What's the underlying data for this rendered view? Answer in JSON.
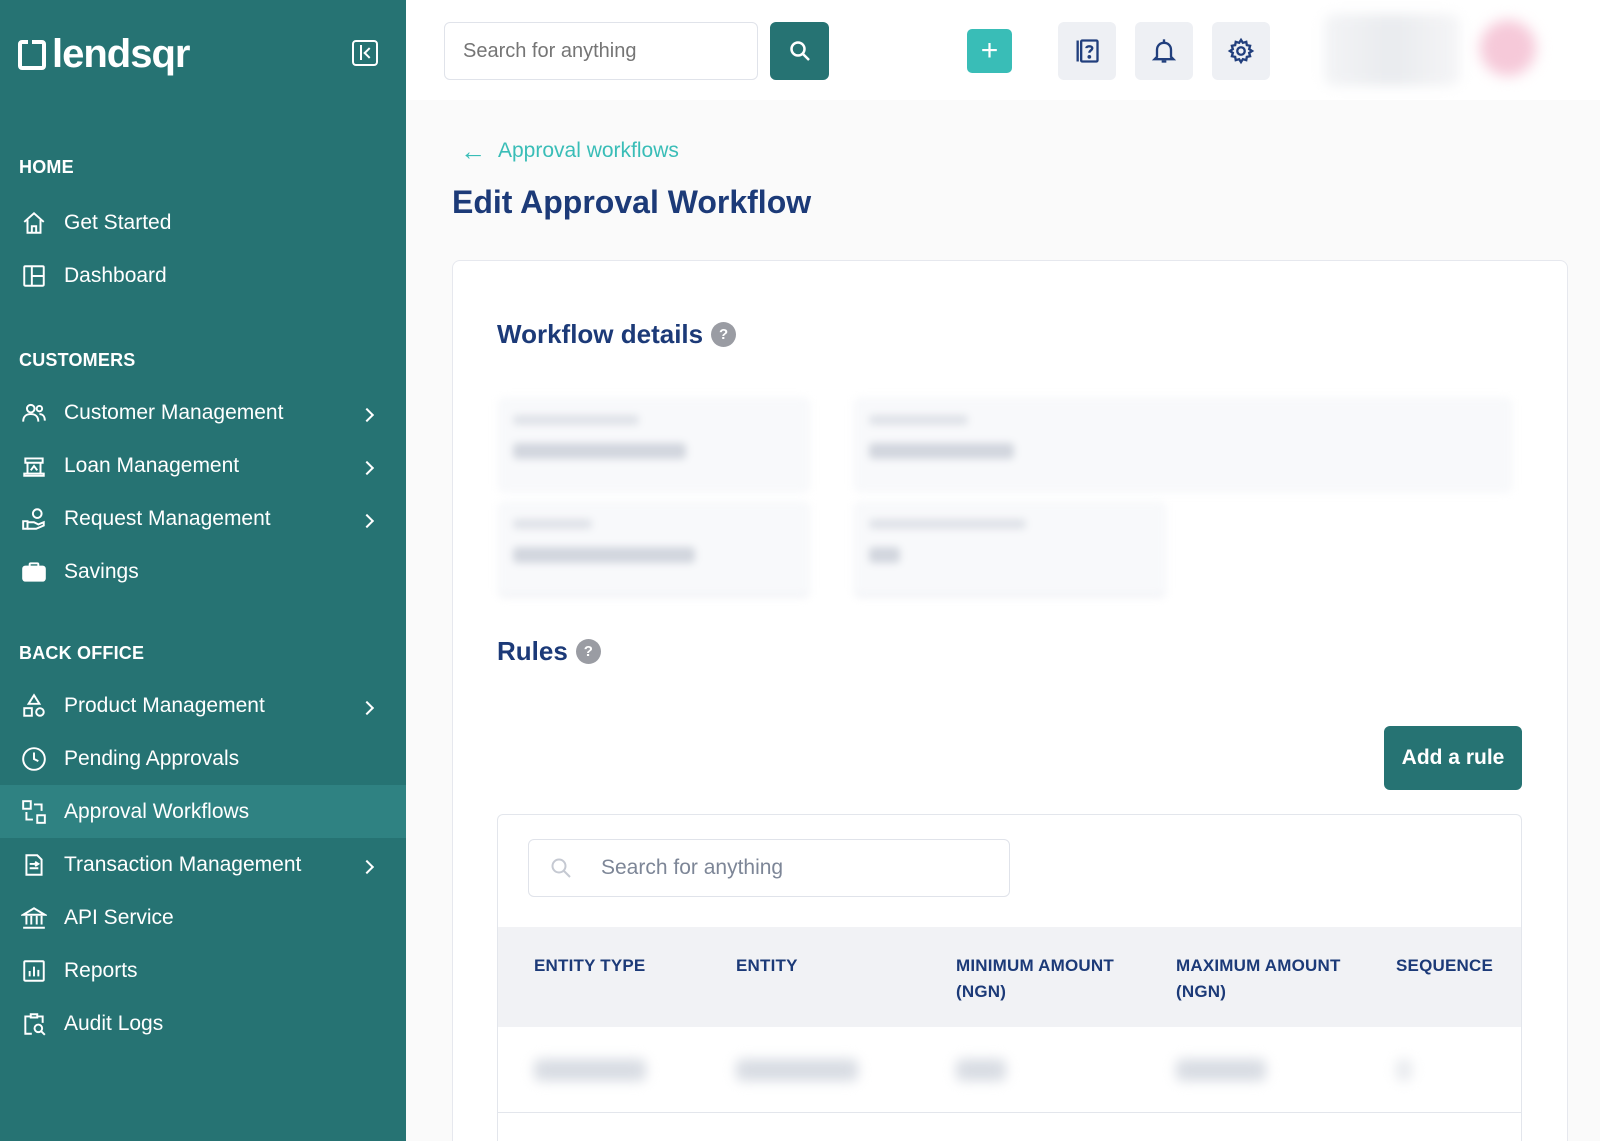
{
  "app": {
    "logo_text": "lendsqr"
  },
  "sidebar": {
    "sections": {
      "home": "HOME",
      "customers": "CUSTOMERS",
      "back_office": "BACK OFFICE"
    },
    "items": [
      {
        "label": "Get Started"
      },
      {
        "label": "Dashboard"
      },
      {
        "label": "Customer Management"
      },
      {
        "label": "Loan Management"
      },
      {
        "label": "Request Management"
      },
      {
        "label": "Savings"
      },
      {
        "label": "Product Management"
      },
      {
        "label": "Pending Approvals"
      },
      {
        "label": "Approval Workflows"
      },
      {
        "label": "Transaction Management"
      },
      {
        "label": "API Service"
      },
      {
        "label": "Reports"
      },
      {
        "label": "Audit Logs"
      }
    ],
    "active_item": "Approval Workflows"
  },
  "topbar": {
    "search_placeholder": "Search for anything",
    "plus_label": "+"
  },
  "main": {
    "breadcrumb": "Approval workflows",
    "title": "Edit Approval Workflow",
    "workflow_details_title": "Workflow details",
    "rules_title": "Rules",
    "help_glyph": "?",
    "add_rule_label": "Add a rule",
    "table": {
      "search_placeholder": "Search for anything",
      "columns": [
        {
          "line1": "ENTITY TYPE",
          "line2": ""
        },
        {
          "line1": "ENTITY",
          "line2": ""
        },
        {
          "line1": "MINIMUM AMOUNT",
          "line2": "(NGN)"
        },
        {
          "line1": "MAXIMUM AMOUNT",
          "line2": "(NGN)"
        },
        {
          "line1": "SEQUENCE",
          "line2": ""
        }
      ]
    }
  },
  "colors": {
    "sidebar_bg": "#267373",
    "accent": "#39bdb7",
    "heading": "#1c3a78"
  }
}
